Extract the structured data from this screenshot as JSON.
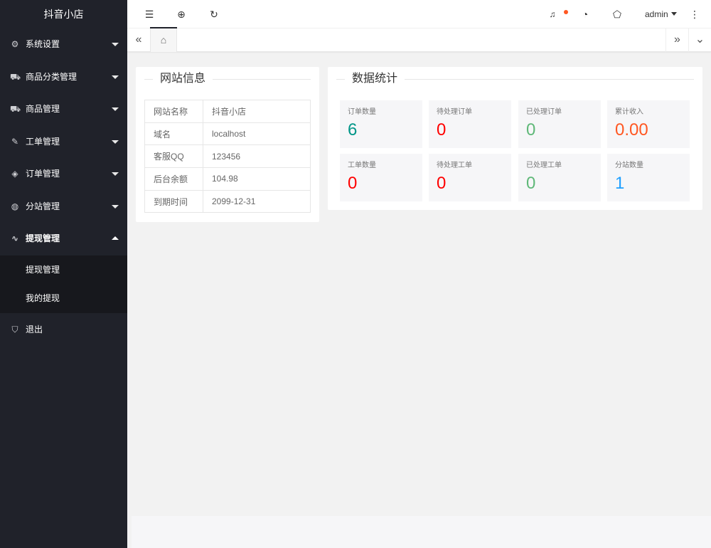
{
  "app": {
    "title": "抖音小店"
  },
  "sidebar": {
    "items": [
      {
        "label": "系统设置",
        "icon": "gear-icon",
        "glyph": "⚙"
      },
      {
        "label": "商品分类管理",
        "icon": "cart-icon",
        "glyph": "🛒"
      },
      {
        "label": "商品管理",
        "icon": "cart-icon",
        "glyph": "🛒"
      },
      {
        "label": "工单管理",
        "icon": "edit-icon",
        "glyph": "✎"
      },
      {
        "label": "订单管理",
        "icon": "layers-icon",
        "glyph": "◈"
      },
      {
        "label": "分站管理",
        "icon": "globe-icon",
        "glyph": "◍"
      },
      {
        "label": "提现管理",
        "icon": "pulse-icon",
        "glyph": "∿"
      }
    ],
    "submenu": [
      {
        "label": "提现管理"
      },
      {
        "label": "我的提现"
      }
    ],
    "exit": {
      "label": "退出",
      "icon": "shield-check-icon",
      "glyph": "⛉"
    }
  },
  "header": {
    "icons": [
      {
        "name": "menu-fold-icon",
        "glyph": "☰"
      },
      {
        "name": "globe-icon",
        "glyph": "⊕"
      },
      {
        "name": "refresh-icon",
        "glyph": "↻"
      },
      {
        "name": "bell-icon",
        "glyph": "🔔"
      },
      {
        "name": "theme-icon",
        "glyph": "◔"
      },
      {
        "name": "tag-icon",
        "glyph": "⌂"
      },
      {
        "name": "more-vertical-icon",
        "glyph": "⋮"
      }
    ],
    "user": "admin"
  },
  "tabs": {
    "prev_glyph": "«",
    "home_glyph": "⌂",
    "next_glyph": "»",
    "dropdown_glyph": "⌄"
  },
  "site_info": {
    "title": "网站信息",
    "rows": [
      {
        "key": "网站名称",
        "value": "抖音小店"
      },
      {
        "key": "域名",
        "value": "localhost"
      },
      {
        "key": "客服QQ",
        "value": "123456"
      },
      {
        "key": "后台余额",
        "value": "104.98"
      },
      {
        "key": "到期时间",
        "value": "2099-12-31"
      }
    ]
  },
  "stats": {
    "title": "数据统计",
    "items": [
      {
        "label": "订单数量",
        "value": "6",
        "color": "#009688"
      },
      {
        "label": "待处理订单",
        "value": "0",
        "color": "#ff0000"
      },
      {
        "label": "已处理订单",
        "value": "0",
        "color": "#5fb878"
      },
      {
        "label": "累计收入",
        "value": "0.00",
        "color": "#ff5722"
      },
      {
        "label": "工单数量",
        "value": "0",
        "color": "#ff0000"
      },
      {
        "label": "待处理工单",
        "value": "0",
        "color": "#ff0000"
      },
      {
        "label": "已处理工单",
        "value": "0",
        "color": "#5fb878"
      },
      {
        "label": "分站数量",
        "value": "1",
        "color": "#1e9fff"
      }
    ]
  }
}
